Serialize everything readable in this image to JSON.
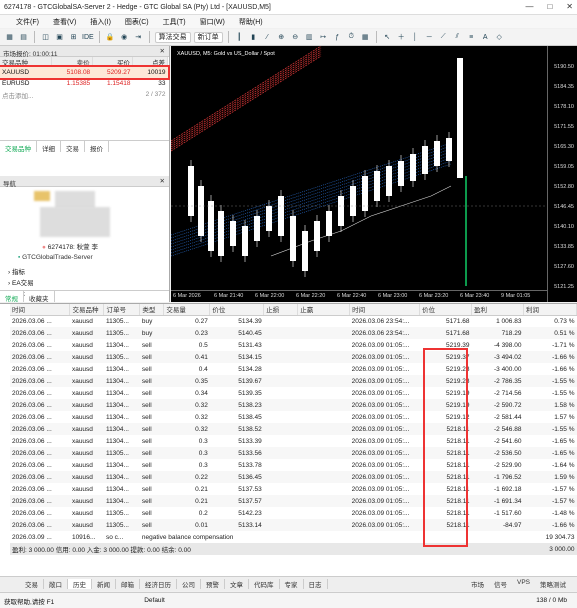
{
  "window": {
    "title": "6274178 - GTCGlobalSA-Server 2 - Hedge - GTC Global SA (Pty) Ltd - [XAUUSD,M5]"
  },
  "menu": [
    "文件(F)",
    "查看(V)",
    "插入(I)",
    "图表(C)",
    "工具(T)",
    "窗口(W)",
    "帮助(H)"
  ],
  "toolbar": {
    "ide": "IDE",
    "new_order": "新订单",
    "algo": "算法交易"
  },
  "market_watch": {
    "header": "市场报价: 01:00:11",
    "columns": [
      "交易品种",
      "卖价",
      "买价",
      "点差"
    ],
    "rows": [
      {
        "symbol": "XAUUSD",
        "bid": "5108.08",
        "ask": "5209.27",
        "spread": "10019"
      },
      {
        "symbol": "EURUSD",
        "bid": "1.15385",
        "ask": "1.15418",
        "spread": "33"
      }
    ],
    "add_label": "点击添加...",
    "count": "2 / 372",
    "tabs": [
      "交易品种",
      "详细",
      "交易",
      "报价"
    ]
  },
  "navigator": {
    "header": "导航",
    "account": "6274178: 秋萱 李",
    "server": "GTCGlobalTrade-Server",
    "items": [
      "指标",
      "EA交易",
      "脚本"
    ],
    "tabs": [
      "常规",
      "收藏夹"
    ]
  },
  "chart": {
    "label": "XAUUSD, M5: Gold vs US_Dollar / Spot",
    "price_ticks": [
      "5190.50",
      "5184.35",
      "5178.10",
      "5171.55",
      "5165.30",
      "5159.05",
      "5152.80",
      "5146.45",
      "5140.10",
      "5133.85",
      "5127.60",
      "5121.25"
    ],
    "time_ticks": [
      "6 Mar 2026",
      "6 Mar 21:40",
      "6 Mar 22:00",
      "6 Mar 22:20",
      "6 Mar 22:40",
      "6 Mar 23:00",
      "6 Mar 23:20",
      "6 Mar 23:40",
      "9 Mar 01:05"
    ]
  },
  "history": {
    "columns": [
      "时间",
      "交易品种",
      "订单号",
      "类型",
      "交易量",
      "价位",
      "止损",
      "止赢",
      "时间",
      "价位",
      "盈利",
      "利润"
    ],
    "rows": [
      [
        "2026.03.06 ...",
        "xauusd",
        "11305...",
        "buy",
        "0.27",
        "5134.39",
        "",
        "",
        "2026.03.06 23:54:...",
        "5171.68",
        "1 006.83",
        "0.73 %"
      ],
      [
        "2026.03.06 ...",
        "xauusd",
        "11305...",
        "buy",
        "0.23",
        "5140.45",
        "",
        "",
        "2026.03.06 23:54:...",
        "5171.68",
        "718.29",
        "0.51 %"
      ],
      [
        "2026.03.06 ...",
        "xauusd",
        "11304...",
        "sell",
        "0.5",
        "5131.43",
        "",
        "",
        "2026.03.09 01:05:...",
        "5219.39",
        "-4 398.00",
        "-1.71 %"
      ],
      [
        "2026.03.06 ...",
        "xauusd",
        "11305...",
        "sell",
        "0.41",
        "5134.15",
        "",
        "",
        "2026.03.09 01:05:...",
        "5219.37",
        "-3 494.02",
        "-1.66 %"
      ],
      [
        "2026.03.06 ...",
        "xauusd",
        "11304...",
        "sell",
        "0.4",
        "5134.28",
        "",
        "",
        "2026.03.09 01:05:...",
        "5219.28",
        "-3 400.00",
        "-1.66 %"
      ],
      [
        "2026.03.06 ...",
        "xauusd",
        "11304...",
        "sell",
        "0.35",
        "5139.67",
        "",
        "",
        "2026.03.09 01:05:...",
        "5219.28",
        "-2 786.35",
        "-1.55 %"
      ],
      [
        "2026.03.06 ...",
        "xauusd",
        "11304...",
        "sell",
        "0.34",
        "5139.35",
        "",
        "",
        "2026.03.09 01:05:...",
        "5219.19",
        "-2 714.56",
        "-1.55 %"
      ],
      [
        "2026.03.06 ...",
        "xauusd",
        "11304...",
        "sell",
        "0.32",
        "5138.23",
        "",
        "",
        "2026.03.09 01:05:...",
        "5219.19",
        "-2 590.72",
        "1.58 %"
      ],
      [
        "2026.03.06 ...",
        "xauusd",
        "11304...",
        "sell",
        "0.32",
        "5138.45",
        "",
        "",
        "2026.03.09 01:05:...",
        "5219.12",
        "-2 581.44",
        "1.57 %"
      ],
      [
        "2026.03.06 ...",
        "xauusd",
        "11304...",
        "sell",
        "0.32",
        "5138.52",
        "",
        "",
        "2026.03.09 01:05:...",
        "5218.11",
        "-2 546.88",
        "-1.55 %"
      ],
      [
        "2026.03.06 ...",
        "xauusd",
        "11304...",
        "sell",
        "0.3",
        "5133.39",
        "",
        "",
        "2026.03.09 01:05:...",
        "5218.11",
        "-2 541.60",
        "-1.65 %"
      ],
      [
        "2026.03.06 ...",
        "xauusd",
        "11305...",
        "sell",
        "0.3",
        "5133.56",
        "",
        "",
        "2026.03.09 01:05:...",
        "5218.11",
        "-2 536.50",
        "-1.65 %"
      ],
      [
        "2026.03.06 ...",
        "xauusd",
        "11304...",
        "sell",
        "0.3",
        "5133.78",
        "",
        "",
        "2026.03.09 01:05:...",
        "5218.11",
        "-2 529.90",
        "-1.64 %"
      ],
      [
        "2026.03.06 ...",
        "xauusd",
        "11304...",
        "sell",
        "0.22",
        "5136.45",
        "",
        "",
        "2026.03.09 01:05:...",
        "5218.11",
        "-1 796.52",
        "1.59 %"
      ],
      [
        "2026.03.06 ...",
        "xauusd",
        "11304...",
        "sell",
        "0.21",
        "5137.53",
        "",
        "",
        "2026.03.09 01:05:...",
        "5218.11",
        "-1 692.18",
        "-1.57 %"
      ],
      [
        "2026.03.06 ...",
        "xauusd",
        "11304...",
        "sell",
        "0.21",
        "5137.57",
        "",
        "",
        "2026.03.09 01:05:...",
        "5218.11",
        "-1 691.34",
        "-1.57 %"
      ],
      [
        "2026.03.06 ...",
        "xauusd",
        "11305...",
        "sell",
        "0.2",
        "5142.23",
        "",
        "",
        "2026.03.09 01:05:...",
        "5218.11",
        "-1 517.60",
        "-1.48 %"
      ],
      [
        "2026.03.06 ...",
        "xauusd",
        "11305...",
        "sell",
        "0.01",
        "5133.14",
        "",
        "",
        "2026.03.09 01:05:...",
        "5218.11",
        "-84.97",
        "-1.66 %"
      ]
    ],
    "balance_row": [
      "2026.03.09 ...",
      "10916...",
      "so c...",
      "negative balance compensation",
      "19 304.73"
    ],
    "total_row": {
      "text": "盈利: 3 000.00  信用: 0.00  入金: 3 000.00  提款: 0.00  结余: 0.00",
      "value": "3 000.00"
    }
  },
  "bottom_tabs": [
    "交易",
    "敞口",
    "历史",
    "新闻",
    "邮箱",
    "经济日历",
    "公司",
    "预警",
    "文章",
    "代码库",
    "专家",
    "日志"
  ],
  "bottom_tabs_right": [
    "市场",
    "信号",
    "VPS",
    "策略测试"
  ],
  "status": {
    "help": "获取帮助,请按 F1",
    "profile": "Default",
    "traffic": "138 / 0 Mb"
  },
  "colors": {
    "negative": "#d22222",
    "positive": "#1a3f9c",
    "highlight_box": "#e33333"
  }
}
